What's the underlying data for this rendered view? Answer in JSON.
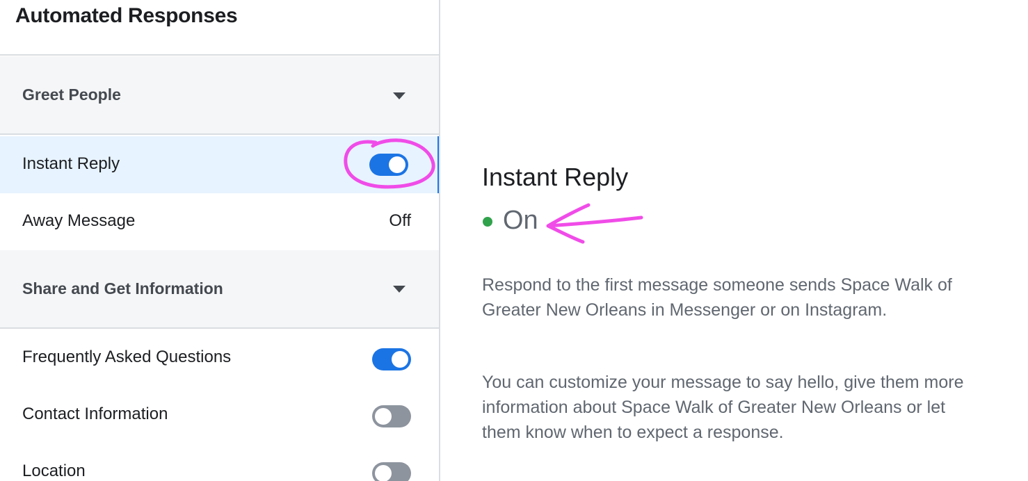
{
  "panel": {
    "title": "Automated Responses"
  },
  "sections": {
    "greet": {
      "label": "Greet People"
    },
    "share": {
      "label": "Share and Get Information"
    }
  },
  "rows": {
    "instant_reply": {
      "label": "Instant Reply",
      "enabled": true
    },
    "away_message": {
      "label": "Away Message",
      "status": "Off"
    },
    "faq": {
      "label": "Frequently Asked Questions",
      "enabled": true
    },
    "contact": {
      "label": "Contact Information",
      "enabled": false
    },
    "location": {
      "label": "Location",
      "enabled": false
    }
  },
  "detail": {
    "title": "Instant Reply",
    "status": "On",
    "status_color": "#31a24c",
    "paragraph1": "Respond to the first message someone sends Space Walk of Greater New Orleans in Messenger or on Instagram.",
    "paragraph2": "You can customize your message to say hello, give them more information about Space Walk of Greater New Orleans or let them know when to expect a response."
  },
  "colors": {
    "accent": "#1b74e4",
    "selected_row_bg": "#e7f3ff",
    "annotation": "#f04ce8"
  }
}
